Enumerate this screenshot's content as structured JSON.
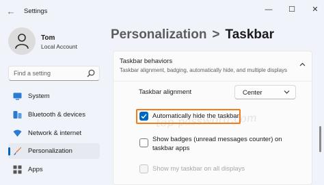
{
  "window": {
    "title": "Settings",
    "back_glyph": "←",
    "minimize_glyph": "—",
    "maximize_glyph": "☐",
    "close_glyph": "✕"
  },
  "profile": {
    "name": "Tom",
    "account": "Local Account"
  },
  "search": {
    "placeholder": "Find a setting",
    "icon": "search-icon"
  },
  "sidebar": {
    "items": [
      {
        "label": "System",
        "icon": "monitor-icon",
        "color": "#2b7bd3"
      },
      {
        "label": "Bluetooth & devices",
        "icon": "bluetooth-icon",
        "color": "#2b7bd3"
      },
      {
        "label": "Network & internet",
        "icon": "wifi-icon",
        "color": "#2b7bd3"
      },
      {
        "label": "Personalization",
        "icon": "brush-icon",
        "color": "#e0792b",
        "active": true
      },
      {
        "label": "Apps",
        "icon": "apps-icon",
        "color": "#555555"
      }
    ]
  },
  "header": {
    "parent": "Personalization",
    "separator": ">",
    "current": "Taskbar"
  },
  "section": {
    "title": "Taskbar behaviors",
    "description": "Taskbar alignment, badging, automatically hide, and multiple displays",
    "expanded": true
  },
  "settings": {
    "alignment_label": "Taskbar alignment",
    "alignment_value": "Center",
    "autohide_label": "Automatically hide the taskbar",
    "autohide_checked": true,
    "badges_line1": "Show badges (unread messages counter) on",
    "badges_line2": "taskbar apps",
    "badges_checked": false,
    "all_displays_label": "Show my taskbar on all displays",
    "all_displays_enabled": false
  },
  "watermark": "top-password.com",
  "colors": {
    "accent": "#0067c0",
    "highlight": "#f07d1a"
  }
}
